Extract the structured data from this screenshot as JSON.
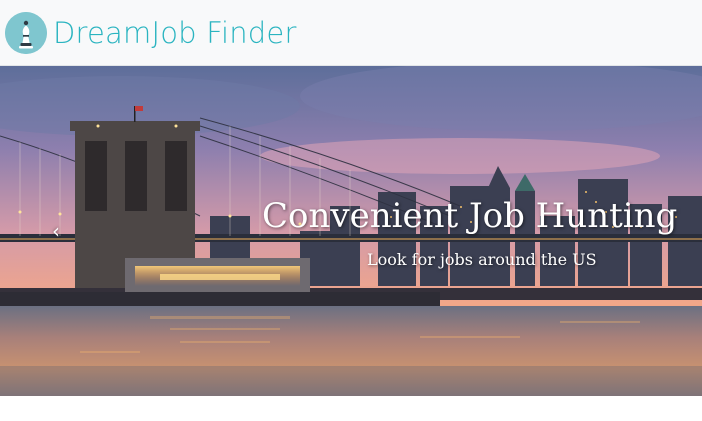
{
  "navbar": {
    "brand": "DreamJob Finder",
    "brand_color": "#2ab4c0",
    "logo_icon": "chess-bishop-icon",
    "logo_bg": "#7fc6cf"
  },
  "hero": {
    "image": "brooklyn-bridge-sunset",
    "title": "Convenient Job Hunting",
    "subtitle": "Look for jobs around the US",
    "prev_icon": "chevron-left-icon",
    "prev_glyph": "‹"
  }
}
